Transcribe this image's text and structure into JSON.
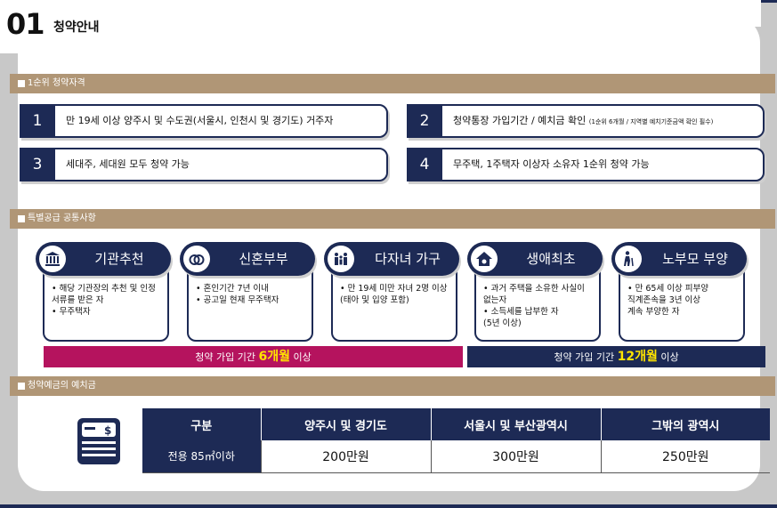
{
  "header": {
    "step_number": "01",
    "step_title": "청약안내"
  },
  "section1": {
    "title": "1순위 청약자격",
    "items": [
      {
        "num": "1",
        "text": "만 19세 이상 양주시 및 수도권(서울시, 인천시 및 경기도) 거주자",
        "note": ""
      },
      {
        "num": "2",
        "text": "청약통장 가입기간 / 예치금 확인",
        "note": "(1순위 6개월 / 지역별 예치기준금액 확인 필수)"
      },
      {
        "num": "3",
        "text": "세대주, 세대원 모두 청약 가능",
        "note": ""
      },
      {
        "num": "4",
        "text": "무주택, 1주택자 이상자 소유자 1순위 청약 가능",
        "note": ""
      }
    ]
  },
  "section2": {
    "title": "특별공급 공통사항",
    "cards": [
      {
        "label": "기관추천",
        "icon": "institution-icon",
        "lines": [
          "• 해당 기관장의 추천 및 인정",
          "   서류를 받은 자",
          "• 무주택자"
        ]
      },
      {
        "label": "신혼부부",
        "icon": "rings-icon",
        "lines": [
          "• 혼인기간 7년 이내",
          "• 공고일 현재 무주택자"
        ]
      },
      {
        "label": "다자녀 가구",
        "icon": "family-icon",
        "lines": [
          "• 만 19세 미만 자녀 2명 이상",
          "   (태아 및 입양 포함)"
        ]
      },
      {
        "label": "생애최초",
        "icon": "house-icon",
        "lines": [
          "• 과거 주택을 소유한 사실이",
          "   없는자",
          "• 소득세를 납부한 자",
          "   (5년 이상)"
        ]
      },
      {
        "label": "노부모 부양",
        "icon": "elderly-icon",
        "lines": [
          "• 만 65세 이상 피부양",
          "   직계존속을 3년 이상",
          "   계속 부양한 자"
        ]
      }
    ],
    "period_bars": [
      {
        "prefix": "청약 가입 기간 ",
        "highlight": "6개월",
        "suffix": " 이상",
        "color": "#b5135e"
      },
      {
        "prefix": "청약 가입 기간 ",
        "highlight": "12개월",
        "suffix": " 이상",
        "color": "#1d2a55"
      }
    ]
  },
  "section3": {
    "title": "청약예금의 예치금",
    "icon": "bankbook-icon",
    "columns": [
      "구분",
      "양주시 및 경기도",
      "서울시 및 부산광역시",
      "그밖의 광역시"
    ],
    "row": {
      "label": "전용 85㎡이하",
      "values": [
        "200만원",
        "300만원",
        "250만원"
      ]
    }
  },
  "colors": {
    "navy": "#1d2a55",
    "tan": "#b09676",
    "magenta": "#b5135e",
    "yellow": "#ffe400"
  }
}
